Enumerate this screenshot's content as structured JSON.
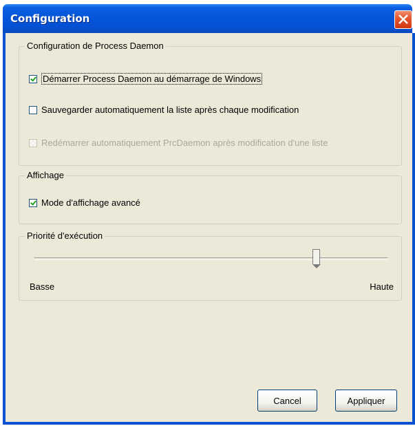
{
  "window": {
    "title": "Configuration"
  },
  "groups": {
    "process": {
      "legend": "Configuration de Process Daemon",
      "options": [
        {
          "label": "Démarrer Process Daemon au démarrage de Windows",
          "checked": true,
          "enabled": true
        },
        {
          "label": "Sauvegarder automatiquement la liste après chaque modification",
          "checked": false,
          "enabled": true
        },
        {
          "label": "Redémarrer automatiquement PrcDaemon après modification d'une liste",
          "checked": false,
          "enabled": false
        }
      ]
    },
    "display": {
      "legend": "Affichage",
      "options": [
        {
          "label": "Mode d'affichage avancé",
          "checked": true,
          "enabled": true
        }
      ]
    },
    "priority": {
      "legend": "Priorité d'exécution",
      "min_label": "Basse",
      "max_label": "Haute",
      "value_fraction": 0.8
    }
  },
  "buttons": {
    "cancel": "Cancel",
    "apply": "Appliquer"
  },
  "colors": {
    "titlebar": "#0554d8",
    "close": "#e4532e",
    "background": "#ece9d8"
  }
}
